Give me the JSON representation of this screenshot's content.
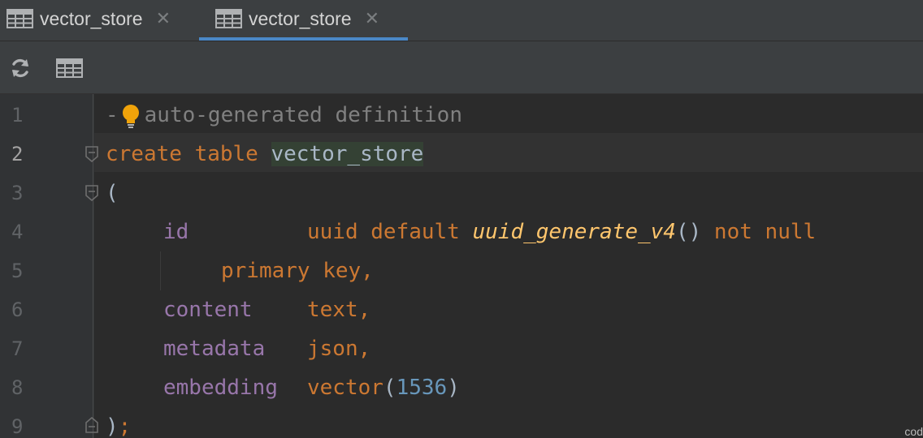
{
  "tabs": [
    {
      "label": "vector_store",
      "active": false,
      "icon": "table-icon"
    },
    {
      "label": "vector_store",
      "active": true,
      "icon": "table-icon"
    }
  ],
  "toolbar": {
    "refresh_icon": "refresh-icon",
    "table_icon": "table-view-icon"
  },
  "editor": {
    "line_numbers": [
      "1",
      "2",
      "3",
      "4",
      "5",
      "6",
      "7",
      "8",
      "9"
    ],
    "current_line": 2,
    "lines": {
      "l1": {
        "dash": "-",
        "comment": "auto-generated definition"
      },
      "l2": {
        "kw1": "create table",
        "name": "vector_store"
      },
      "l3": {
        "text": "("
      },
      "l4": {
        "col": "id",
        "type": "uuid default",
        "fn": "uuid_generate_v4",
        "paren": "()",
        "rest": "not null"
      },
      "l5": {
        "text": "primary key,"
      },
      "l6": {
        "col": "content",
        "type": "text,"
      },
      "l7": {
        "col": "metadata",
        "type": "json,"
      },
      "l8": {
        "col": "embedding",
        "type": "vector",
        "open": "(",
        "num": "1536",
        "close": ")"
      },
      "l9": {
        "close": ")",
        "semi": ";"
      }
    }
  },
  "corner_text": "cod"
}
